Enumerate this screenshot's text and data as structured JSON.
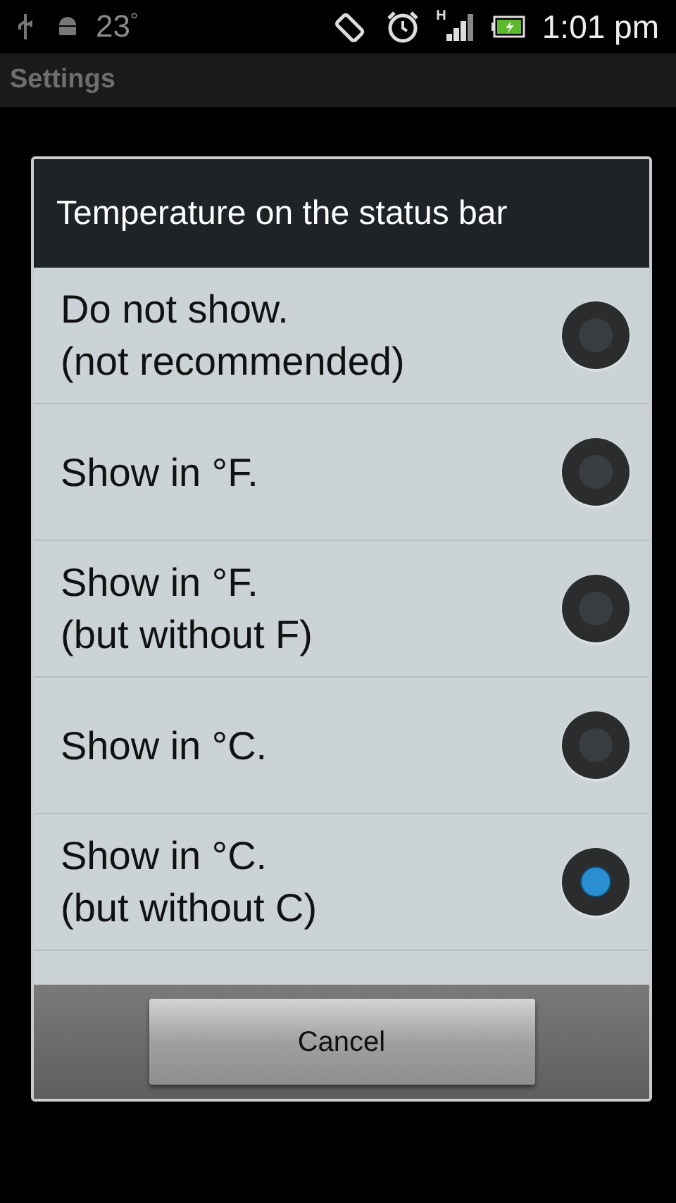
{
  "status_bar": {
    "temperature": "23",
    "degree": "°",
    "network": "H",
    "time": "1:01 pm"
  },
  "action_bar": {
    "title": "Settings"
  },
  "dialog": {
    "title": "Temperature on the status bar",
    "options": [
      {
        "lines": [
          "Do not show.",
          "(not recommended)"
        ],
        "selected": false
      },
      {
        "lines": [
          "Show in °F."
        ],
        "selected": false
      },
      {
        "lines": [
          "Show in °F.",
          "(but without F)"
        ],
        "selected": false
      },
      {
        "lines": [
          "Show in °C."
        ],
        "selected": false
      },
      {
        "lines": [
          "Show in °C.",
          "(but without C)"
        ],
        "selected": true
      }
    ],
    "button": "Cancel"
  }
}
